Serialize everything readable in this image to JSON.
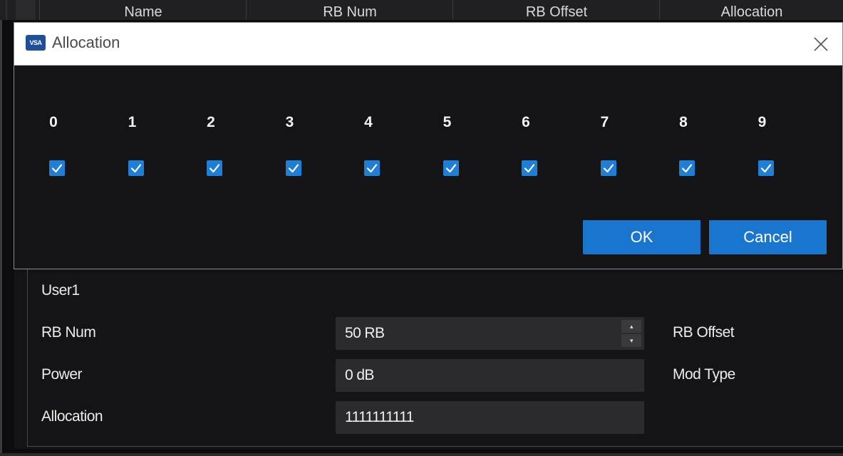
{
  "background_table": {
    "columns": [
      "Name",
      "RB Num",
      "RB Offset",
      "Allocation"
    ]
  },
  "dialog": {
    "icon_text": "VSA",
    "title": "Allocation",
    "allocation_indices": [
      "0",
      "1",
      "2",
      "3",
      "4",
      "5",
      "6",
      "7",
      "8",
      "9"
    ],
    "checked": [
      true,
      true,
      true,
      true,
      true,
      true,
      true,
      true,
      true,
      true
    ],
    "ok_label": "OK",
    "cancel_label": "Cancel"
  },
  "panel": {
    "user": "User1",
    "rb_num_label": "RB Num",
    "rb_num_value": "50 RB",
    "rb_offset_label": "RB Offset",
    "power_label": "Power",
    "power_value": "0 dB",
    "mod_type_label": "Mod Type",
    "allocation_label": "Allocation",
    "allocation_value": "1111111111"
  },
  "colors": {
    "accent": "#1a75cf",
    "checkbox": "#1f7fd6",
    "background": "#141416",
    "field": "#2b2b2e"
  }
}
